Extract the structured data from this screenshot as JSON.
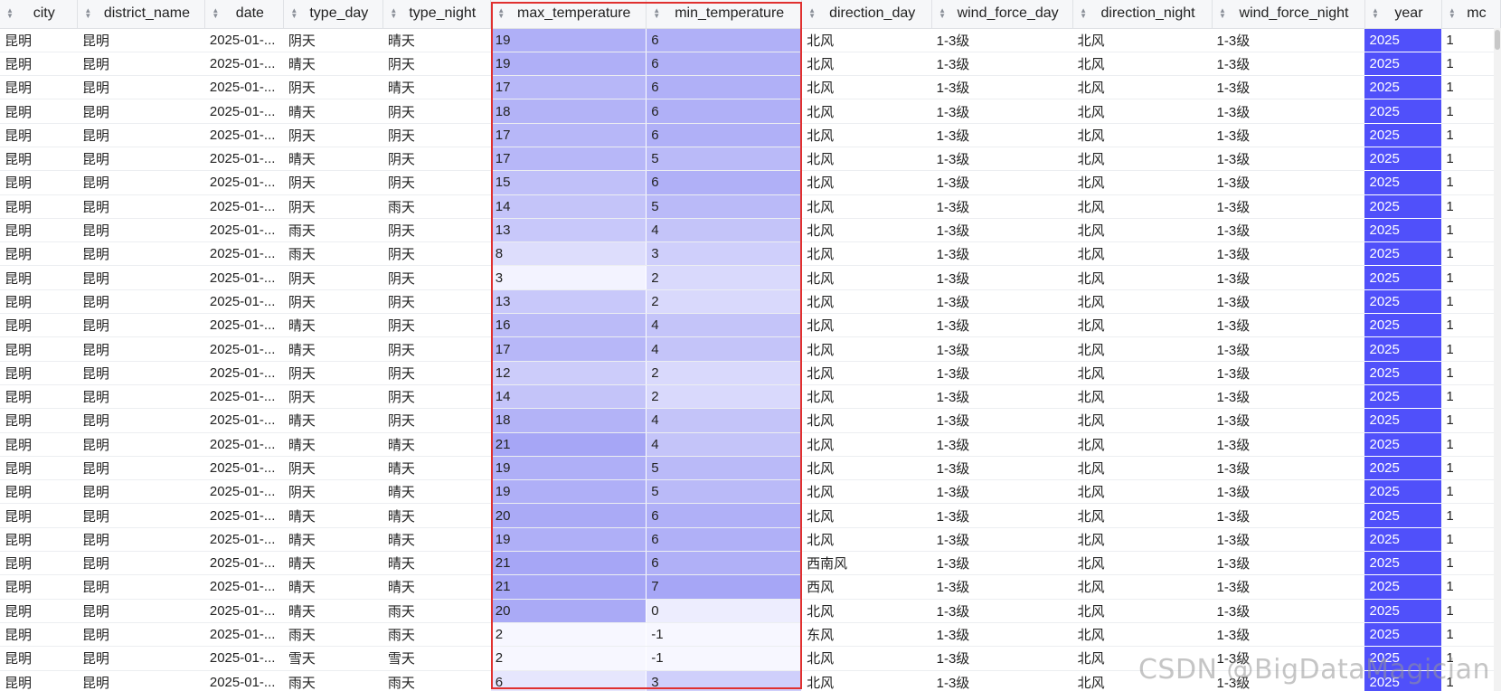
{
  "columns": [
    {
      "key": "city",
      "label": "city"
    },
    {
      "key": "district_name",
      "label": "district_name"
    },
    {
      "key": "date",
      "label": "date"
    },
    {
      "key": "type_day",
      "label": "type_day"
    },
    {
      "key": "type_night",
      "label": "type_night"
    },
    {
      "key": "max_temperature",
      "label": "max_temperature"
    },
    {
      "key": "min_temperature",
      "label": "min_temperature"
    },
    {
      "key": "direction_day",
      "label": "direction_day"
    },
    {
      "key": "wind_force_day",
      "label": "wind_force_day"
    },
    {
      "key": "direction_night",
      "label": "direction_night"
    },
    {
      "key": "wind_force_night",
      "label": "wind_force_night"
    },
    {
      "key": "year",
      "label": "year"
    },
    {
      "key": "month",
      "label": "mc"
    }
  ],
  "rows": [
    [
      "昆明",
      "昆明",
      "2025-01-...",
      "阴天",
      "晴天",
      "19",
      "6",
      "北风",
      "1-3级",
      "北风",
      "1-3级",
      "2025",
      "1"
    ],
    [
      "昆明",
      "昆明",
      "2025-01-...",
      "晴天",
      "阴天",
      "19",
      "6",
      "北风",
      "1-3级",
      "北风",
      "1-3级",
      "2025",
      "1"
    ],
    [
      "昆明",
      "昆明",
      "2025-01-...",
      "阴天",
      "晴天",
      "17",
      "6",
      "北风",
      "1-3级",
      "北风",
      "1-3级",
      "2025",
      "1"
    ],
    [
      "昆明",
      "昆明",
      "2025-01-...",
      "晴天",
      "阴天",
      "18",
      "6",
      "北风",
      "1-3级",
      "北风",
      "1-3级",
      "2025",
      "1"
    ],
    [
      "昆明",
      "昆明",
      "2025-01-...",
      "阴天",
      "阴天",
      "17",
      "6",
      "北风",
      "1-3级",
      "北风",
      "1-3级",
      "2025",
      "1"
    ],
    [
      "昆明",
      "昆明",
      "2025-01-...",
      "晴天",
      "阴天",
      "17",
      "5",
      "北风",
      "1-3级",
      "北风",
      "1-3级",
      "2025",
      "1"
    ],
    [
      "昆明",
      "昆明",
      "2025-01-...",
      "阴天",
      "阴天",
      "15",
      "6",
      "北风",
      "1-3级",
      "北风",
      "1-3级",
      "2025",
      "1"
    ],
    [
      "昆明",
      "昆明",
      "2025-01-...",
      "阴天",
      "雨天",
      "14",
      "5",
      "北风",
      "1-3级",
      "北风",
      "1-3级",
      "2025",
      "1"
    ],
    [
      "昆明",
      "昆明",
      "2025-01-...",
      "雨天",
      "阴天",
      "13",
      "4",
      "北风",
      "1-3级",
      "北风",
      "1-3级",
      "2025",
      "1"
    ],
    [
      "昆明",
      "昆明",
      "2025-01-...",
      "雨天",
      "阴天",
      "8",
      "3",
      "北风",
      "1-3级",
      "北风",
      "1-3级",
      "2025",
      "1"
    ],
    [
      "昆明",
      "昆明",
      "2025-01-...",
      "阴天",
      "阴天",
      "3",
      "2",
      "北风",
      "1-3级",
      "北风",
      "1-3级",
      "2025",
      "1"
    ],
    [
      "昆明",
      "昆明",
      "2025-01-...",
      "阴天",
      "阴天",
      "13",
      "2",
      "北风",
      "1-3级",
      "北风",
      "1-3级",
      "2025",
      "1"
    ],
    [
      "昆明",
      "昆明",
      "2025-01-...",
      "晴天",
      "阴天",
      "16",
      "4",
      "北风",
      "1-3级",
      "北风",
      "1-3级",
      "2025",
      "1"
    ],
    [
      "昆明",
      "昆明",
      "2025-01-...",
      "晴天",
      "阴天",
      "17",
      "4",
      "北风",
      "1-3级",
      "北风",
      "1-3级",
      "2025",
      "1"
    ],
    [
      "昆明",
      "昆明",
      "2025-01-...",
      "阴天",
      "阴天",
      "12",
      "2",
      "北风",
      "1-3级",
      "北风",
      "1-3级",
      "2025",
      "1"
    ],
    [
      "昆明",
      "昆明",
      "2025-01-...",
      "阴天",
      "阴天",
      "14",
      "2",
      "北风",
      "1-3级",
      "北风",
      "1-3级",
      "2025",
      "1"
    ],
    [
      "昆明",
      "昆明",
      "2025-01-...",
      "晴天",
      "阴天",
      "18",
      "4",
      "北风",
      "1-3级",
      "北风",
      "1-3级",
      "2025",
      "1"
    ],
    [
      "昆明",
      "昆明",
      "2025-01-...",
      "晴天",
      "晴天",
      "21",
      "4",
      "北风",
      "1-3级",
      "北风",
      "1-3级",
      "2025",
      "1"
    ],
    [
      "昆明",
      "昆明",
      "2025-01-...",
      "阴天",
      "晴天",
      "19",
      "5",
      "北风",
      "1-3级",
      "北风",
      "1-3级",
      "2025",
      "1"
    ],
    [
      "昆明",
      "昆明",
      "2025-01-...",
      "阴天",
      "晴天",
      "19",
      "5",
      "北风",
      "1-3级",
      "北风",
      "1-3级",
      "2025",
      "1"
    ],
    [
      "昆明",
      "昆明",
      "2025-01-...",
      "晴天",
      "晴天",
      "20",
      "6",
      "北风",
      "1-3级",
      "北风",
      "1-3级",
      "2025",
      "1"
    ],
    [
      "昆明",
      "昆明",
      "2025-01-...",
      "晴天",
      "晴天",
      "19",
      "6",
      "北风",
      "1-3级",
      "北风",
      "1-3级",
      "2025",
      "1"
    ],
    [
      "昆明",
      "昆明",
      "2025-01-...",
      "晴天",
      "晴天",
      "21",
      "6",
      "西南风",
      "1-3级",
      "北风",
      "1-3级",
      "2025",
      "1"
    ],
    [
      "昆明",
      "昆明",
      "2025-01-...",
      "晴天",
      "晴天",
      "21",
      "7",
      "西风",
      "1-3级",
      "北风",
      "1-3级",
      "2025",
      "1"
    ],
    [
      "昆明",
      "昆明",
      "2025-01-...",
      "晴天",
      "雨天",
      "20",
      "0",
      "北风",
      "1-3级",
      "北风",
      "1-3级",
      "2025",
      "1"
    ],
    [
      "昆明",
      "昆明",
      "2025-01-...",
      "雨天",
      "雨天",
      "2",
      "-1",
      "东风",
      "1-3级",
      "北风",
      "1-3级",
      "2025",
      "1"
    ],
    [
      "昆明",
      "昆明",
      "2025-01-...",
      "雪天",
      "雪天",
      "2",
      "-1",
      "北风",
      "1-3级",
      "北风",
      "1-3级",
      "2025",
      "1"
    ],
    [
      "昆明",
      "昆明",
      "2025-01-...",
      "雨天",
      "雨天",
      "6",
      "3",
      "北风",
      "1-3级",
      "北风",
      "1-3级",
      "2025",
      "1"
    ]
  ],
  "heatmap": {
    "max_temperature": {
      "min": 2,
      "max": 21
    },
    "min_temperature": {
      "min": -1,
      "max": 7
    },
    "year_color": "#5050fa",
    "low_color": "#f7f7ff",
    "high_color": "#a6a6f6"
  },
  "highlight_color": "#e0302f",
  "watermark": "CSDN @BigDataMagician"
}
